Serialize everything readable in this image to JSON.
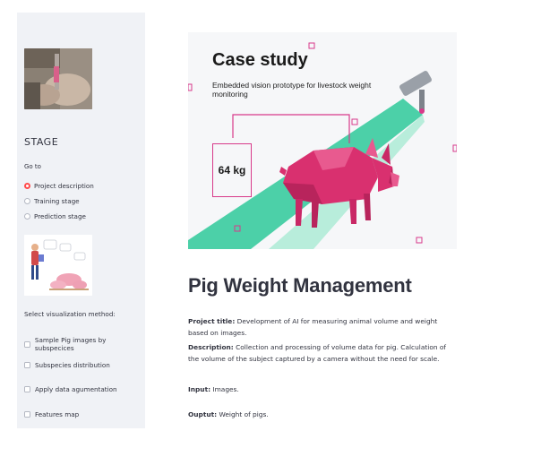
{
  "sidebar": {
    "title": "STAGE",
    "goto_label": "Go to",
    "radio_options": [
      {
        "label": "Project description",
        "selected": true
      },
      {
        "label": "Training stage",
        "selected": false
      },
      {
        "label": "Prediction stage",
        "selected": false
      }
    ],
    "select_label": "Select visualization method:",
    "checkboxes": [
      {
        "label": "Sample Pig images by subspecices",
        "checked": false
      },
      {
        "label": "Subspecies distribution",
        "checked": false
      },
      {
        "label": "Apply data agumentation",
        "checked": false
      },
      {
        "label": "Features map",
        "checked": false
      }
    ]
  },
  "hero": {
    "title": "Case study",
    "subtitle": "Embedded vision prototype for livestock weight monitoring",
    "weight": "64 kg"
  },
  "main": {
    "title": "Pig Weight Management",
    "project_title_label": "Project title:",
    "project_title_value": " Development of AI for measuring animal volume and weight based on images.",
    "description_label": "Description:",
    "description_value": " Collection and processing of volume data for pig. Calculation of the volume of the subject captured by a camera without the need for scale.",
    "input_label": "Input:",
    "input_value": " Images.",
    "output_label": "Ouptut:",
    "output_value": " Weight of pigs."
  },
  "colors": {
    "accent": "#ff4b4b",
    "sidebar_bg": "#f0f2f6",
    "pig_pink": "#d9306f",
    "teal": "#2ec99a"
  }
}
